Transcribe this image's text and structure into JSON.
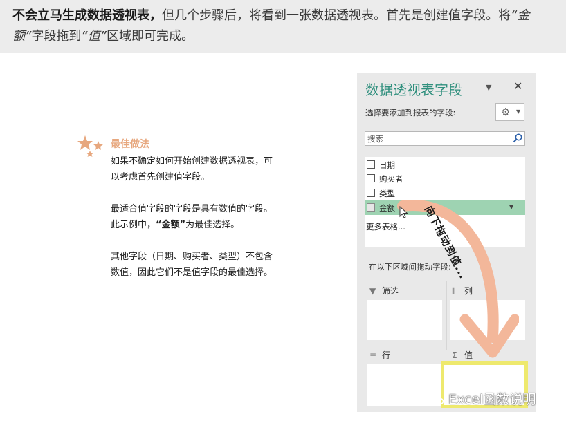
{
  "header": {
    "bold_lead": "不会立马生成数据透视表，",
    "text_1": "但几个步骤后，将看到一张数据透视表。首先是创建值字段。将",
    "italic_amount": "“金额”",
    "text_2": "字段拖到",
    "italic_value": "“值”",
    "text_3": "区域即可完成。"
  },
  "tip": {
    "title": "最佳做法",
    "para1": "如果不确定如何开始创建数据透视表，可以考虑首先创建值字段。",
    "para2_a": "最适合值字段的字段是具有数值的字段。此示例中，",
    "para2_bold": "“金额”",
    "para2_b": "为最佳选择。",
    "para3": "其他字段（日期、购买者、类型）不包含数值，因此它们不是值字段的最佳选择。"
  },
  "pane": {
    "title": "数据透视表字段",
    "dropdown_icon": "caret-down-icon",
    "close_label": "✕",
    "choose_label": "选择要添加到报表的字段:",
    "tools_icon": "gear-icon",
    "search_placeholder": "搜索",
    "fields": [
      {
        "label": "日期",
        "checked": false,
        "active": false
      },
      {
        "label": "购买者",
        "checked": false,
        "active": false
      },
      {
        "label": "类型",
        "checked": false,
        "active": false
      },
      {
        "label": "金额",
        "checked": false,
        "active": true
      }
    ],
    "more_tables": "更多表格...",
    "drag_label": "在以下区域间拖动字段:",
    "areas": {
      "filters": "筛选",
      "columns": "列",
      "rows": "行",
      "values": "值"
    }
  },
  "drag_hint": "向下拖动到值...",
  "watermark": "Excel函数说明",
  "colors": {
    "accent_title": "#2f8f7d",
    "active_field": "#9ed3b2",
    "arrow": "#f3b79a",
    "values_highlight": "#eee96e",
    "tip_title": "#e7a77e"
  }
}
